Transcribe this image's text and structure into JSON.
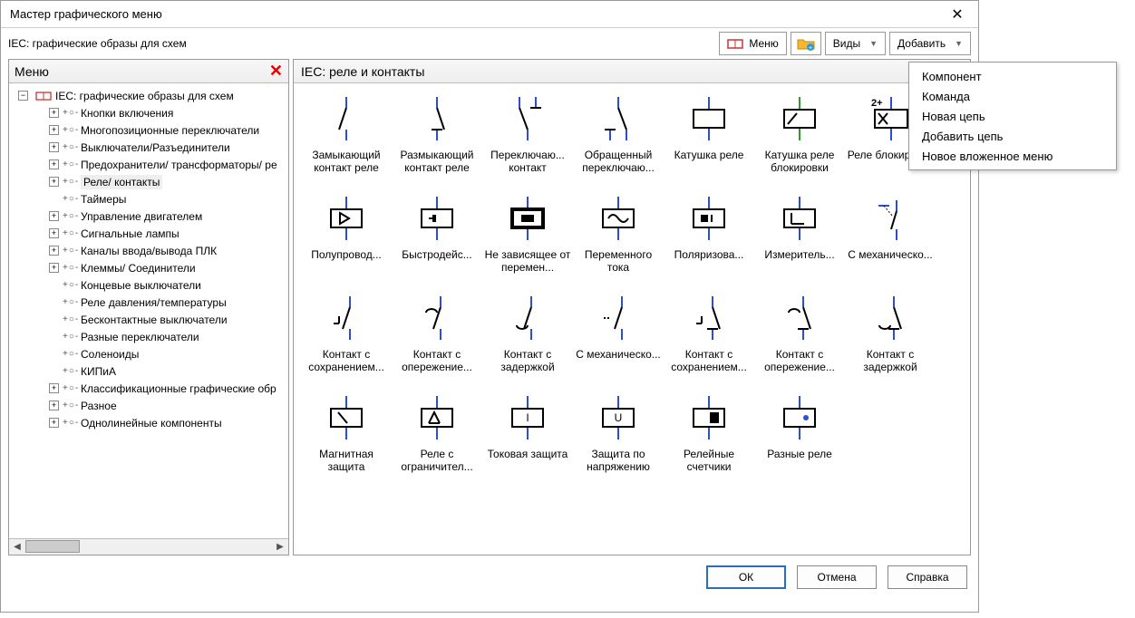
{
  "window": {
    "title": "Мастер графического меню",
    "close_icon": "✕"
  },
  "subheader": {
    "path": "IEC: графические образы для схем"
  },
  "toolbar": {
    "menu_label": "Меню",
    "views_label": "Виды",
    "add_label": "Добавить"
  },
  "left_panel": {
    "title": "Меню",
    "delete_icon": "✕"
  },
  "tree": {
    "root": "IEC: графические образы для схем",
    "items": [
      {
        "label": "Кнопки включения",
        "expandable": true
      },
      {
        "label": "Многопозиционные переключатели",
        "expandable": true
      },
      {
        "label": "Выключатели/Разъединители",
        "expandable": true
      },
      {
        "label": "Предохранители/ трансформаторы/ ре",
        "expandable": true
      },
      {
        "label": "Реле/ контакты",
        "expandable": true,
        "selected": true
      },
      {
        "label": "Таймеры",
        "expandable": false
      },
      {
        "label": "Управление двигателем",
        "expandable": true
      },
      {
        "label": "Сигнальные лампы",
        "expandable": true
      },
      {
        "label": "Каналы ввода/вывода ПЛК",
        "expandable": true
      },
      {
        "label": "Клеммы/ Соединители",
        "expandable": true
      },
      {
        "label": "Концевые выключатели",
        "expandable": false
      },
      {
        "label": "Реле давления/температуры",
        "expandable": false
      },
      {
        "label": "Бесконтактные выключатели",
        "expandable": false
      },
      {
        "label": "Разные переключатели",
        "expandable": false
      },
      {
        "label": "Соленоиды",
        "expandable": false
      },
      {
        "label": "КИПиА",
        "expandable": false
      },
      {
        "label": "Классификационные графические обр",
        "expandable": true
      },
      {
        "label": "Разное",
        "expandable": true
      },
      {
        "label": "Однолинейные компоненты",
        "expandable": true
      }
    ]
  },
  "right_panel": {
    "title": "IEC: реле и контакты"
  },
  "grid_items": [
    {
      "label": "Замыкающий контакт реле",
      "icon": "contact-no"
    },
    {
      "label": "Размыкающий контакт реле",
      "icon": "contact-nc"
    },
    {
      "label": "Переключаю... контакт",
      "icon": "contact-co"
    },
    {
      "label": "Обращенный переключаю...",
      "icon": "contact-co-rev"
    },
    {
      "label": "Катушка реле",
      "icon": "coil"
    },
    {
      "label": "Катушка реле блокировки",
      "icon": "coil-lock"
    },
    {
      "label": "Реле блокировки",
      "icon": "coil-lock2"
    },
    {
      "label": "Полупровод...",
      "icon": "box-tri"
    },
    {
      "label": "Быстродейс...",
      "icon": "box-fast"
    },
    {
      "label": "Не зависящее от перемен...",
      "icon": "box-bold"
    },
    {
      "label": "Переменного тока",
      "icon": "box-ac"
    },
    {
      "label": "Поляризова...",
      "icon": "box-pol"
    },
    {
      "label": "Измеритель...",
      "icon": "box-meas"
    },
    {
      "label": "С механическо...",
      "icon": "mech-link"
    },
    {
      "label": "Контакт с сохранением...",
      "icon": "sc-ret"
    },
    {
      "label": "Контакт с опережение...",
      "icon": "sc-lead"
    },
    {
      "label": "Контакт с задержкой",
      "icon": "sc-delay"
    },
    {
      "label": "С механическо...",
      "icon": "sc-mech"
    },
    {
      "label": "Контакт с сохранением...",
      "icon": "sc-ret2"
    },
    {
      "label": "Контакт с опережение...",
      "icon": "sc-lead2"
    },
    {
      "label": "Контакт с задержкой",
      "icon": "sc-delay2"
    },
    {
      "label": "Магнитная защита",
      "icon": "box-mag"
    },
    {
      "label": "Реле с ограничител...",
      "icon": "box-limit"
    },
    {
      "label": "Токовая защита",
      "icon": "box-i"
    },
    {
      "label": "Защита по напряжению",
      "icon": "box-u"
    },
    {
      "label": "Релейные счетчики",
      "icon": "box-count"
    },
    {
      "label": "Разные реле",
      "icon": "box-misc"
    }
  ],
  "dropdown": {
    "items": [
      "Компонент",
      "Команда",
      "Новая цепь",
      "Добавить цепь",
      "Новое вложенное меню"
    ]
  },
  "footer": {
    "ok": "ОК",
    "cancel": "Отмена",
    "help": "Справка"
  }
}
